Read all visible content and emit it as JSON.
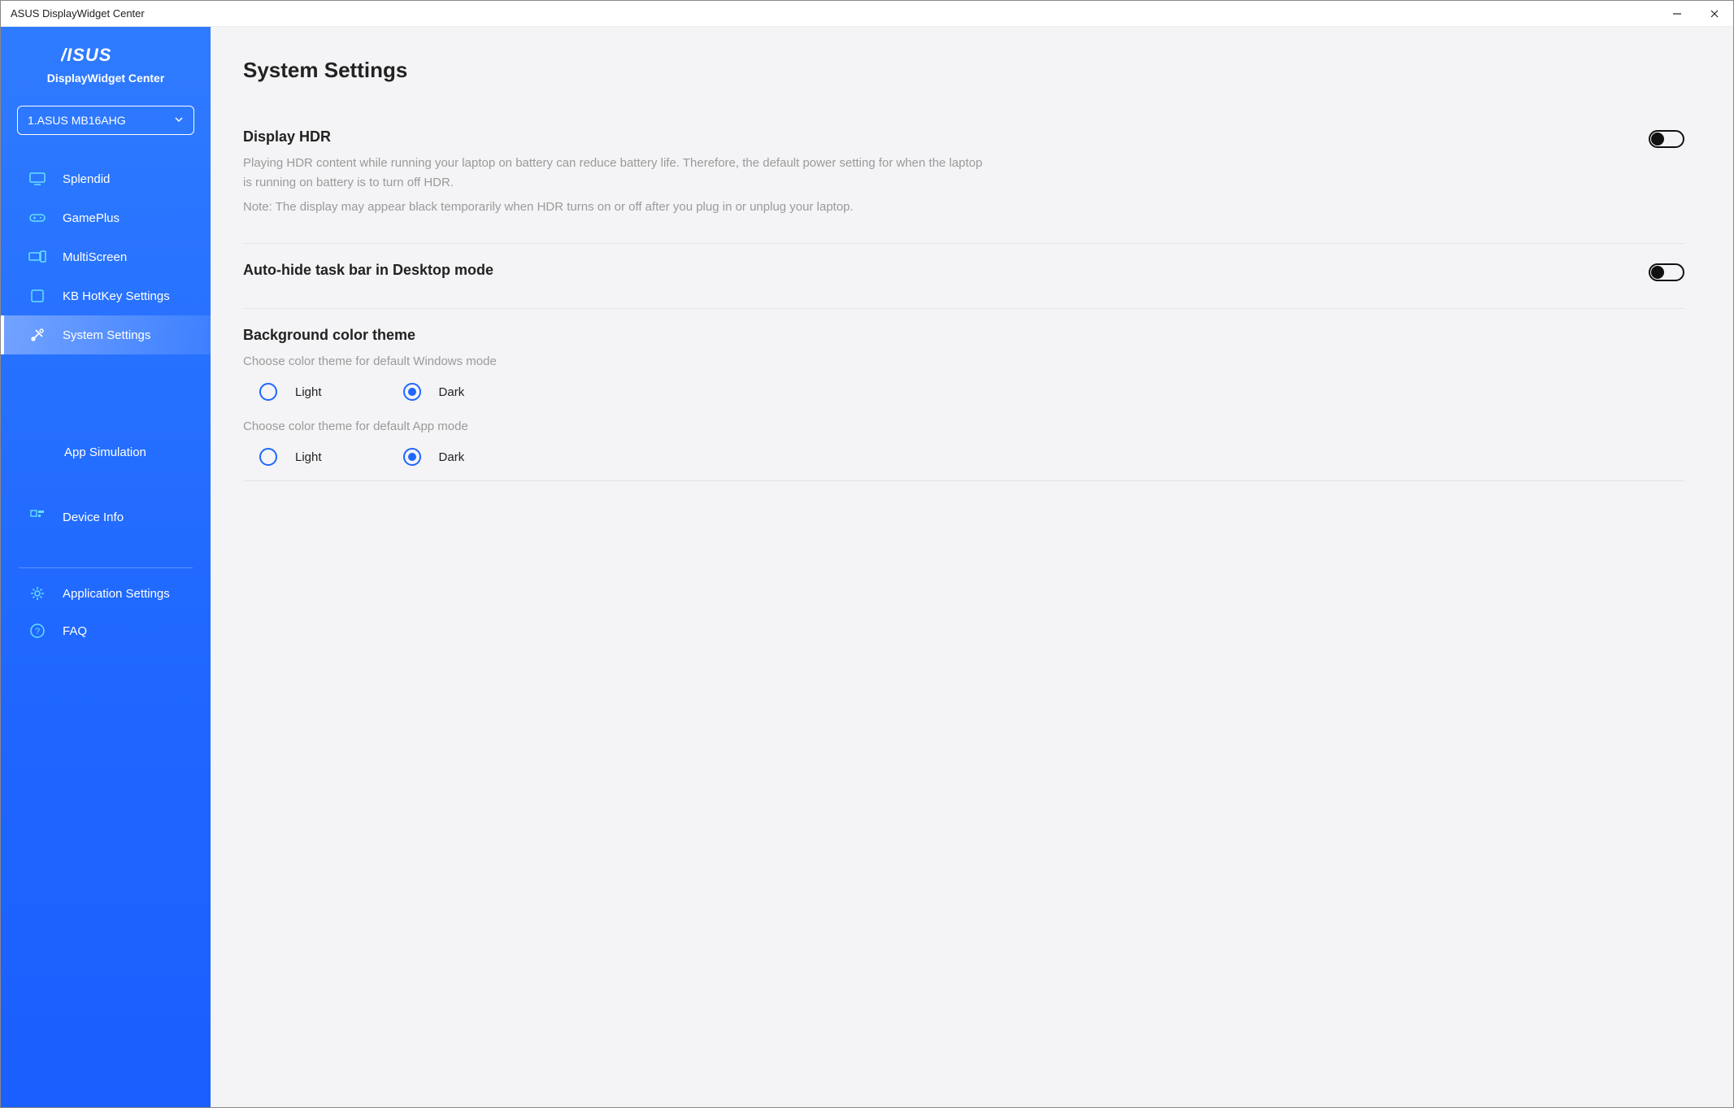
{
  "window": {
    "title": "ASUS DisplayWidget Center"
  },
  "brand": {
    "name": "ASUS",
    "product": "DisplayWidget Center"
  },
  "device_selector": {
    "selected": "1.ASUS MB16AHG"
  },
  "sidebar": {
    "items": [
      {
        "label": "Splendid"
      },
      {
        "label": "GamePlus"
      },
      {
        "label": "MultiScreen"
      },
      {
        "label": "KB HotKey Settings"
      },
      {
        "label": "System Settings"
      }
    ],
    "sub_item": {
      "label": "App Simulation"
    },
    "device_info": {
      "label": "Device Info"
    },
    "bottom": {
      "app_settings": "Application Settings",
      "faq": "FAQ"
    }
  },
  "main": {
    "title": "System Settings",
    "hdr": {
      "title": "Display HDR",
      "desc1": "Playing HDR content while running your laptop on battery can reduce battery life. Therefore, the default power setting for when the laptop is running on battery is to turn off HDR.",
      "desc2": "Note: The display may appear black temporarily when HDR turns on or off after you plug in or unplug your laptop.",
      "toggle_on": false
    },
    "taskbar": {
      "title": "Auto-hide task bar in Desktop mode",
      "toggle_on": false
    },
    "theme": {
      "title": "Background color theme",
      "windows_label": "Choose color theme for default Windows mode",
      "app_label": "Choose color theme for default App mode",
      "options": {
        "light": "Light",
        "dark": "Dark"
      },
      "windows_selected": "dark",
      "app_selected": "dark"
    }
  }
}
